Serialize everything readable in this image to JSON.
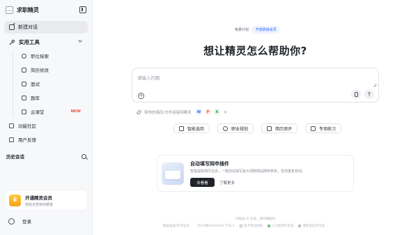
{
  "brand": {
    "logo_alt": "logo",
    "name": "求职精灵"
  },
  "sidebar": {
    "new_chat": "新建对话",
    "tools_label": "实用工具",
    "tools": [
      {
        "label": "职位探索",
        "icon": "compass-icon"
      },
      {
        "label": "简历修改",
        "icon": "document-edit-icon"
      },
      {
        "label": "面试",
        "icon": "graduation-cap-icon"
      },
      {
        "label": "题库",
        "icon": "book-icon"
      },
      {
        "label": "云课堂",
        "icon": "cloud-class-icon",
        "badge": "NEW"
      }
    ],
    "community": "功能社区",
    "feedback": "用户反馈",
    "history_label": "历史会话",
    "vip": {
      "title": "开通精灵会员",
      "subtitle": "获取无限使用额度",
      "icon": "♛"
    },
    "login": "登录"
  },
  "plan": {
    "free": "免费计划",
    "separator": "|",
    "upgrade": "开通高级会员"
  },
  "hero": {
    "title": "想让精灵怎么帮助你?"
  },
  "input": {
    "placeholder": "请输入问题"
  },
  "attach": {
    "hint": "导你的简历/文件连接到精灵",
    "chips": [
      "W",
      "P",
      "X"
    ],
    "close": "×"
  },
  "chips": [
    {
      "label": "智能选岗",
      "icon": "briefcase-icon"
    },
    {
      "label": "职业规划",
      "icon": "sparkle-icon"
    },
    {
      "label": "简历测评",
      "icon": "resume-icon"
    },
    {
      "label": "专项练习",
      "icon": "practice-book-icon"
    }
  ],
  "plugin": {
    "title": "自动填写网申插件",
    "desc": "智能提取简历信息，一键自动填写各大招聘网站网申表单，告别重复劳动。",
    "button": "去看看",
    "more": "了解更多"
  },
  "footer": {
    "notice": "内容由 AI 生成，请仔细甄别",
    "items": [
      "网站备案/许可证号：",
      "京ICP备2023018177号-1",
      "电子营业执照",
      "人力资源许可证",
      "增值电信许可证"
    ]
  },
  "colors": {
    "accent": "#2f6bff",
    "new_badge": "#f2553d",
    "vip_gold": "#f5a21b"
  }
}
